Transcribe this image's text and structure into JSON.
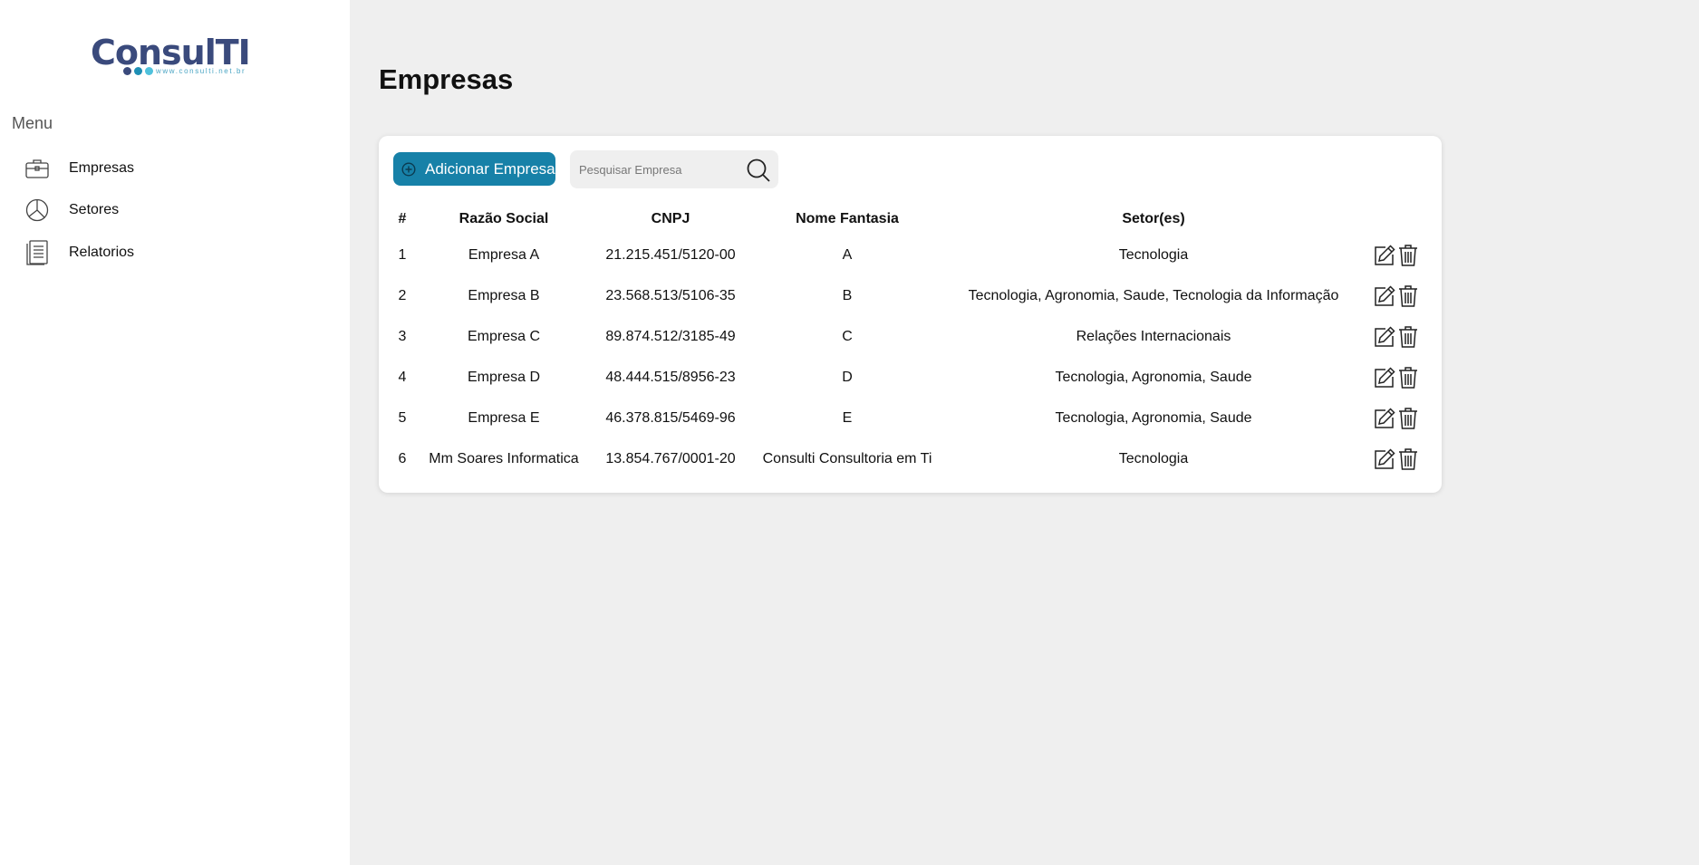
{
  "brand": {
    "logo_text": "ConsulTI",
    "logo_url_text": "www.consulti.net.br",
    "colors": {
      "primary": "#1781a8",
      "logo_dark": "#3a4a7c",
      "logo_light": "#1e8fb5",
      "dot_a": "#3a4a7c",
      "dot_b": "#1e8fb5",
      "dot_c": "#4fc1dc"
    }
  },
  "sidebar": {
    "menu_title": "Menu",
    "items": [
      {
        "label": "Empresas",
        "icon": "briefcase-icon"
      },
      {
        "label": "Setores",
        "icon": "pie-chart-icon"
      },
      {
        "label": "Relatorios",
        "icon": "report-icon"
      }
    ]
  },
  "main": {
    "title": "Empresas",
    "add_button_label": "Adicionar Empresa",
    "search_placeholder": "Pesquisar Empresa",
    "table": {
      "headers": [
        "#",
        "Razão Social",
        "CNPJ",
        "Nome Fantasia",
        "Setor(es)",
        ""
      ],
      "rows": [
        {
          "num": "1",
          "razao": "Empresa A",
          "cnpj": "21.215.451/5120-00",
          "nome": "A",
          "setores": "Tecnologia"
        },
        {
          "num": "2",
          "razao": "Empresa B",
          "cnpj": "23.568.513/5106-35",
          "nome": "B",
          "setores": "Tecnologia, Agronomia, Saude, Tecnologia da Informação"
        },
        {
          "num": "3",
          "razao": "Empresa C",
          "cnpj": "89.874.512/3185-49",
          "nome": "C",
          "setores": "Relações Internacionais"
        },
        {
          "num": "4",
          "razao": "Empresa D",
          "cnpj": "48.444.515/8956-23",
          "nome": "D",
          "setores": "Tecnologia, Agronomia, Saude"
        },
        {
          "num": "5",
          "razao": "Empresa E",
          "cnpj": "46.378.815/5469-96",
          "nome": "E",
          "setores": "Tecnologia, Agronomia, Saude"
        },
        {
          "num": "6",
          "razao": "Mm Soares Informatica",
          "cnpj": "13.854.767/0001-20",
          "nome": "Consulti Consultoria em Ti",
          "setores": "Tecnologia"
        }
      ]
    }
  }
}
